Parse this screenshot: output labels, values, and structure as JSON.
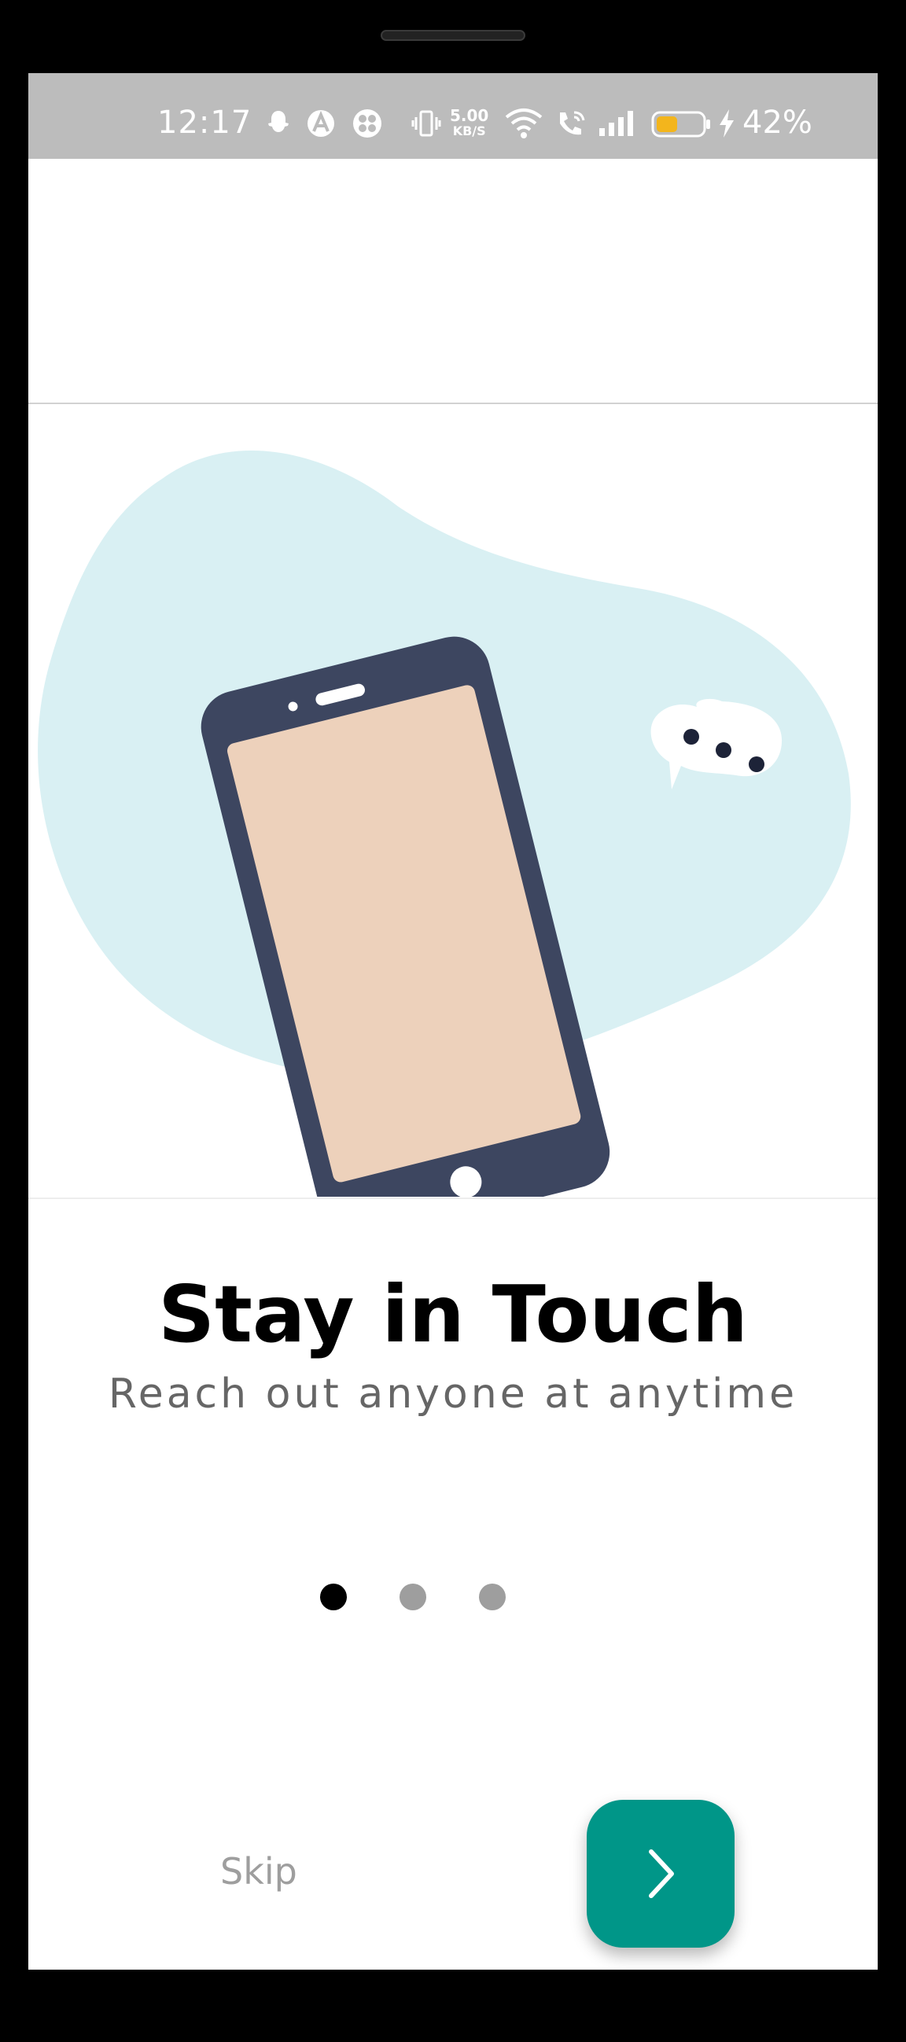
{
  "status_bar": {
    "time": "12:17",
    "net_speed_value": "5.00",
    "net_speed_unit": "KB/S",
    "battery_percent": "42%",
    "icons": [
      "snapchat-icon",
      "arc-icon",
      "app-icon",
      "vibrate-icon",
      "wifi-icon",
      "wifi-call-icon",
      "signal-icon",
      "battery-icon",
      "charging-icon"
    ]
  },
  "illustration": {
    "name": "phone-chat-illustration",
    "colors": {
      "blob": "#d9f0f3",
      "phone_body": "#3d4660",
      "phone_screen": "#edd1bb",
      "bubble": "#ffffff",
      "bubble_dots": "#1d2338"
    }
  },
  "onboarding": {
    "title": "Stay in Touch",
    "subtitle": "Reach out anyone at anytime",
    "pages": 3,
    "active_page": 0
  },
  "actions": {
    "skip_label": "Skip",
    "next_icon": "chevron-right-icon"
  },
  "colors": {
    "accent": "#009688",
    "status_bar_bg": "#bcbcbc",
    "dot_inactive": "#9e9e9e",
    "dot_active": "#000000",
    "skip_text": "#9e9e9e",
    "subtitle_text": "#666666"
  }
}
